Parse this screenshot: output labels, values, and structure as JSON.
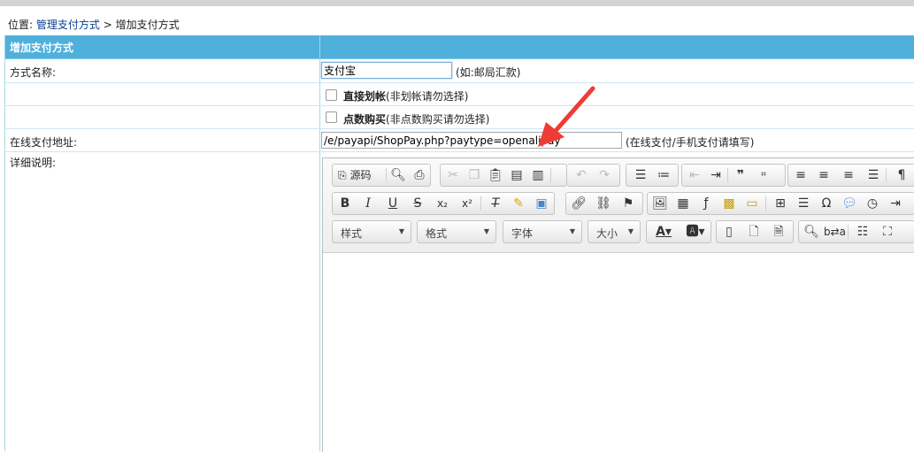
{
  "breadcrumb": {
    "prefix": "位置:",
    "link": "管理支付方式",
    "sep": ">",
    "current": "增加支付方式"
  },
  "header": {
    "title": "增加支付方式"
  },
  "form": {
    "name_label": "方式名称:",
    "name_value": "支付宝",
    "name_hint": "(如:邮局汇款)",
    "direct_label": "直接划帐",
    "direct_hint": "(非划帐请勿选择)",
    "points_label": "点数购买",
    "points_hint": "(非点数购买请勿选择)",
    "url_label": "在线支付地址:",
    "url_value": "/e/payapi/ShopPay.php?paytype=openalipay",
    "url_hint": "(在线支付/手机支付请填写)",
    "desc_label": "详细说明:"
  },
  "editor": {
    "source_label": "源码",
    "combo_style": "样式",
    "combo_format": "格式",
    "combo_font": "字体",
    "combo_size": "大小"
  },
  "colors": {
    "header_bg": "#4fb0dc",
    "arrow": "#ef3b36"
  }
}
